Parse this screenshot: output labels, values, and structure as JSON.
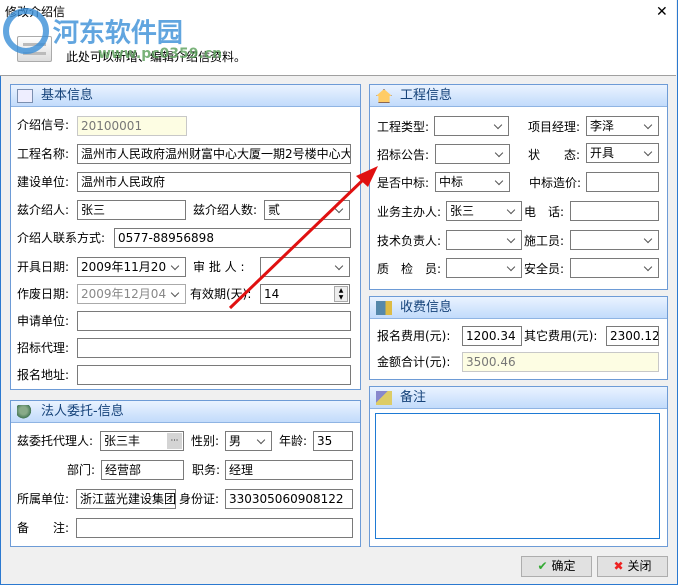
{
  "window": {
    "title": "修改介绍信",
    "close": "✕",
    "description": "此处可以新增、编辑介绍信资料。",
    "watermark": "河东软件园 www.pc0359.cn"
  },
  "basic": {
    "title": "基本信息",
    "letter_no_label": "介绍信号:",
    "letter_no": "20100001",
    "project_name_label": "工程名称:",
    "project_name": "温州市人民政府温州财富中心大厦一期2号楼中心大",
    "builder_label": "建设单位:",
    "builder": "温州市人民政府",
    "introducer_label": "兹介绍人:",
    "introducer": "张三",
    "introducer_count_label": "兹介绍人数:",
    "introducer_count": "贰",
    "contact_label": "介绍人联系方式:",
    "contact": "0577-88956898",
    "issue_date_label": "开具日期:",
    "issue_date": "2009年11月20",
    "approver_label": "审 批 人 :",
    "approver": "",
    "void_date_label": "作废日期:",
    "void_date": "2009年12月04",
    "validity_label": "有效期(天):",
    "validity": "14",
    "applicant_label": "申请单位:",
    "applicant": "",
    "agent_label": "招标代理:",
    "agent": "",
    "address_label": "报名地址:",
    "address": ""
  },
  "legal": {
    "title": "法人委托-信息",
    "proxy_label": "兹委托代理人:",
    "proxy": "张三丰",
    "browse": "···",
    "gender_label": "性别:",
    "gender": "男",
    "age_label": "年龄:",
    "age": "35",
    "dept_label": "部门:",
    "dept": "经营部",
    "position_label": "职务:",
    "position": "经理",
    "company_label": "所属单位:",
    "company": "浙江蓝光建设集团",
    "id_label": "身份证:",
    "id": "330305060908122",
    "remark_label": "备　　注:",
    "remark": ""
  },
  "project": {
    "title": "工程信息",
    "type_label": "工程类型:",
    "type": "",
    "manager_label": "项目经理:",
    "manager": "李泽",
    "notice_label": "招标公告:",
    "notice": "",
    "status_label": "状　　态:",
    "status": "开具",
    "won_label": "是否中标:",
    "won": "中标",
    "price_label": "中标造价:",
    "price": "",
    "handler_label": "业务主办人:",
    "handler": "张三",
    "phone_label": "电　话:",
    "phone": "",
    "tech_label": "技术负责人:",
    "tech": "",
    "builder_label": "施工员:",
    "builder": "",
    "qc_label": "质　检　员:",
    "qc": "",
    "safety_label": "安全员:",
    "safety": ""
  },
  "fees": {
    "title": "收费信息",
    "reg_label": "报名费用(元):",
    "reg": "1200.34",
    "other_label": "其它费用(元):",
    "other": "2300.12",
    "total_label": "金额合计(元):",
    "total": "3500.46"
  },
  "notes": {
    "title": "备注",
    "value": ""
  },
  "buttons": {
    "ok": "确定",
    "close": "关闭"
  },
  "colors": {
    "accent": "#2b79d0",
    "arrow": "#e01010"
  }
}
